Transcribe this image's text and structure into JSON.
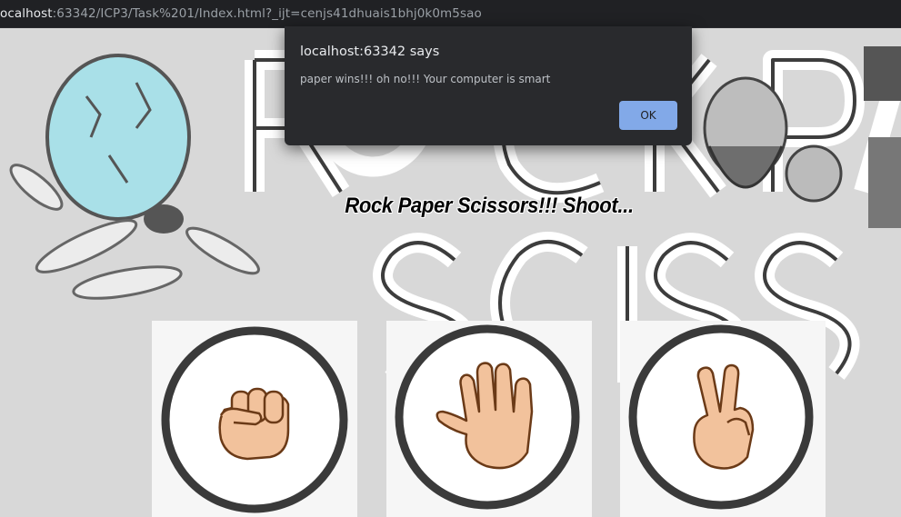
{
  "browser": {
    "url_host": "ocalhost",
    "url_rest": ":63342/ICP3/Task%201/Index.html?_ijt=cenjs41dhuais1bhj0k0m5sao"
  },
  "page": {
    "heading": "Rock Paper Scissors!!! Shoot...",
    "choices": [
      {
        "id": "rock",
        "icon": "fist-icon"
      },
      {
        "id": "paper",
        "icon": "open-hand-icon"
      },
      {
        "id": "scissors",
        "icon": "victory-hand-icon"
      }
    ]
  },
  "dialog": {
    "title": "localhost:63342 says",
    "message": "paper wins!!! oh no!!! Your computer is smart",
    "ok_label": "OK"
  },
  "colors": {
    "chrome_bg": "#202124",
    "dialog_bg": "#292a2d",
    "ok_button": "#8ab4f8",
    "skin": "#f2c29c",
    "skin_outline": "#6b3a17",
    "ring": "#3a3a3a"
  }
}
